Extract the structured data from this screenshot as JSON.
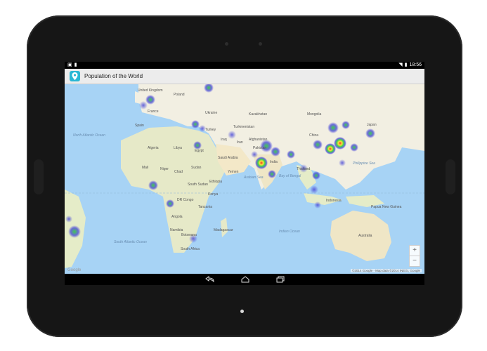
{
  "status": {
    "time": "18:56",
    "left_icons": [
      "notification-icon",
      "sd-card-icon"
    ],
    "right_icons": [
      "wifi-icon",
      "battery-icon"
    ]
  },
  "app": {
    "title": "Population of the World",
    "icon": "location-pin-icon",
    "accent": "#2ab7d4"
  },
  "map": {
    "labels": {
      "north_atlantic": "North Atlantic Ocean",
      "united_kingdom": "United Kingdom",
      "poland": "Poland",
      "france": "France",
      "spain": "Spain",
      "algeria": "Algeria",
      "libya": "Libya",
      "egypt": "Egypt",
      "mali": "Mali",
      "niger": "Niger",
      "chad": "Chad",
      "sudan": "Sudan",
      "south_sudan": "South Sudan",
      "ethiopia": "Ethiopia",
      "kenya": "Kenya",
      "dr_congo": "DR Congo",
      "angola": "Angola",
      "tanzania": "Tanzania",
      "namibia": "Namibia",
      "botswana": "Botswana",
      "south_africa": "South Africa",
      "madagascar": "Madagascar",
      "ukraine": "Ukraine",
      "turkey": "Turkey",
      "kazakhstan": "Kazakhstan",
      "mongolia": "Mongolia",
      "turkmenistan": "Turkmenistan",
      "afghanistan": "Afghanistan",
      "pakistan": "Pakistan",
      "iran": "Iran",
      "iraq": "Iraq",
      "saudi_arabia": "Saudi Arabia",
      "yemen": "Yemen",
      "india": "India",
      "china": "China",
      "japan": "Japan",
      "thailand": "Thailand",
      "indonesia": "Indonesia",
      "papua_new_guinea": "Papua New Guinea",
      "australia": "Australia",
      "south_atlantic": "South Atlantic Ocean",
      "indian_ocean": "Indian Ocean",
      "arabian_sea": "Arabian Sea",
      "bay_of_bengal": "Bay of Bengal",
      "philippine_sea": "Philippine Sea"
    },
    "zoom_in": "+",
    "zoom_out": "−",
    "attribution": "©2014 Google · Map data ©2014 INEGI, Google",
    "google_logo": "Google"
  },
  "heatmap_colors": {
    "low": "#4b4bd8",
    "mid": "#3fd24a",
    "high": "#ffe23a",
    "peak": "#e8322a"
  },
  "nav": {
    "back": "back-icon",
    "home": "home-icon",
    "recent": "recent-apps-icon"
  }
}
